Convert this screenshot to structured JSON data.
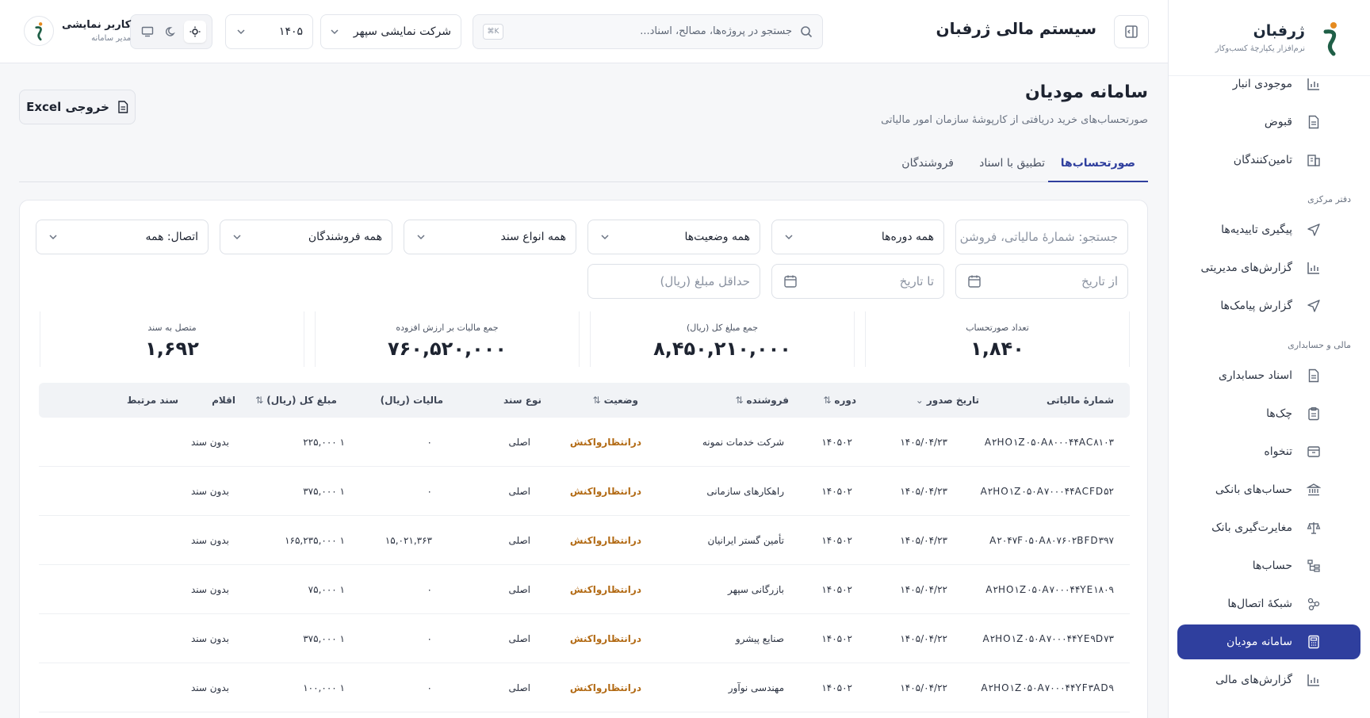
{
  "brand": {
    "name": "ژرفبان",
    "tagline": "نرم‌افزار یکپارچهٔ کسب‌وکار"
  },
  "sidebar": {
    "items": [
      {
        "type": "item",
        "label": "موجودی انبار",
        "icon": "chart-icon"
      },
      {
        "type": "item",
        "label": "قبوض",
        "icon": "document-icon"
      },
      {
        "type": "item",
        "label": "تامین‌کنندگان",
        "icon": "building-icon"
      },
      {
        "type": "section",
        "label": "دفتر مرکزی"
      },
      {
        "type": "item",
        "label": "پیگیری تاییدیه‌ها",
        "icon": "send-icon"
      },
      {
        "type": "item",
        "label": "گزارش‌های مدیریتی",
        "icon": "chart-icon"
      },
      {
        "type": "item",
        "label": "گزارش پیامک‌ها",
        "icon": "send-icon"
      },
      {
        "type": "section",
        "label": "مالی و حسابداری"
      },
      {
        "type": "item",
        "label": "اسناد حسابداری",
        "icon": "document-icon"
      },
      {
        "type": "item",
        "label": "چک‌ها",
        "icon": "clipboard-icon"
      },
      {
        "type": "item",
        "label": "تنخواه",
        "icon": "box-icon"
      },
      {
        "type": "item",
        "label": "حساب‌های بانکی",
        "icon": "bank-icon"
      },
      {
        "type": "item",
        "label": "مغایرت‌گیری بانک",
        "icon": "scale-icon"
      },
      {
        "type": "item",
        "label": "حساب‌ها",
        "icon": "tree-icon"
      },
      {
        "type": "item",
        "label": "شبکهٔ اتصال‌ها",
        "icon": "network-icon"
      },
      {
        "type": "item",
        "label": "سامانه مودیان",
        "icon": "calculator-icon",
        "active": true
      },
      {
        "type": "item",
        "label": "گزارش‌های مالی",
        "icon": "chart-icon"
      }
    ]
  },
  "topbar": {
    "title": "سیستم مالی ژرفبان",
    "search_placeholder": "جستجو در پروژه‌ها، مصالح، اسناد...",
    "search_shortcut": "K⌘",
    "company": "شرکت نمایشی سپهر",
    "year": "۱۴۰۵",
    "user_name": "کاربر نمایشی",
    "user_role": "مدیر سامانه"
  },
  "page": {
    "title": "سامانه مودیان",
    "subtitle": "صورتحساب‌های خرید دریافتی از کارپوشهٔ سازمان امور مالیاتی",
    "export_label": "خروجی Excel"
  },
  "tabs": [
    "صورتحساب‌ها",
    "تطبیق با اسناد",
    "فروشندگان"
  ],
  "filters": {
    "search_placeholder": "جستجو: شمارهٔ مالیاتی، فروشن",
    "period": "همه دوره‌ها",
    "status": "همه وضعیت‌ها",
    "doc_type": "همه انواع سند",
    "seller": "همه فروشندگان",
    "link": "اتصال: همه",
    "from_date": "از تاریخ",
    "to_date": "تا تاریخ",
    "min_amount": "حداقل مبلغ (ریال)"
  },
  "stats": [
    {
      "label": "تعداد صورتحساب",
      "value": "۱,۸۴۰"
    },
    {
      "label": "جمع مبلغ کل (ریال)",
      "value": "۸,۴۵۰,۲۱۰,۰۰۰"
    },
    {
      "label": "جمع مالیات بر ارزش افزوده",
      "value": "۷۶۰,۵۲۰,۰۰۰"
    },
    {
      "label": "متصل به سند",
      "value": "۱,۶۹۲"
    }
  ],
  "table": {
    "headers": [
      "شمارهٔ مالیاتی",
      "تاریخ صدور",
      "دوره",
      "فروشنده",
      "وضعیت",
      "نوع سند",
      "مالیات (ریال)",
      "مبلغ کل (ریال)",
      "اقلام",
      "سند مرتبط"
    ],
    "rows": [
      [
        "A۲HO۱Z۰۵۰A۸۰۰۰۴۴AC۸۱۰۳",
        "۱۴۰۵/۰۴/۲۳",
        "۱۴۰۵۰۲",
        "شرکت خدمات نمونه",
        "درانتظارواکنش",
        "اصلی",
        "۰",
        "۱ ۲۲۵,۰۰۰",
        "بدون سند"
      ],
      [
        "A۲HO۱Z۰۵۰A۷۰۰۰۴۴ACFD۵۲",
        "۱۴۰۵/۰۴/۲۳",
        "۱۴۰۵۰۲",
        "راهکارهای سازمانی",
        "درانتظارواکنش",
        "اصلی",
        "۰",
        "۱ ۳۷۵,۰۰۰",
        "بدون سند"
      ],
      [
        "A۲۰۴۷F۰۵۰A۸۰۷۶۰۲BFD۳۹۷",
        "۱۴۰۵/۰۴/۲۳",
        "۱۴۰۵۰۲",
        "تأمین گستر ایرانیان",
        "درانتظارواکنش",
        "اصلی",
        "۱۵,۰۲۱,۳۶۳",
        "۱ ۱۶۵,۲۳۵,۰۰۰",
        "بدون سند"
      ],
      [
        "A۲HO۱Z۰۵۰A۷۰۰۰۴۴YE۱۸۰۹",
        "۱۴۰۵/۰۴/۲۲",
        "۱۴۰۵۰۲",
        "بازرگانی سپهر",
        "درانتظارواکنش",
        "اصلی",
        "۰",
        "۱ ۷۵,۰۰۰",
        "بدون سند"
      ],
      [
        "A۲HO۱Z۰۵۰A۷۰۰۰۴۴YE۹D۷۳",
        "۱۴۰۵/۰۴/۲۲",
        "۱۴۰۵۰۲",
        "صنایع پیشرو",
        "درانتظارواکنش",
        "اصلی",
        "۰",
        "۱ ۳۷۵,۰۰۰",
        "بدون سند"
      ],
      [
        "A۲HO۱Z۰۵۰A۷۰۰۰۴۴YF۳AD۹",
        "۱۴۰۵/۰۴/۲۲",
        "۱۴۰۵۰۲",
        "مهندسی نوآور",
        "درانتظارواکنش",
        "اصلی",
        "۰",
        "۱ ۱۰۰,۰۰۰",
        "بدون سند"
      ]
    ]
  },
  "colors": {
    "accent": "#2f3f9e",
    "status": "#b26a14"
  }
}
